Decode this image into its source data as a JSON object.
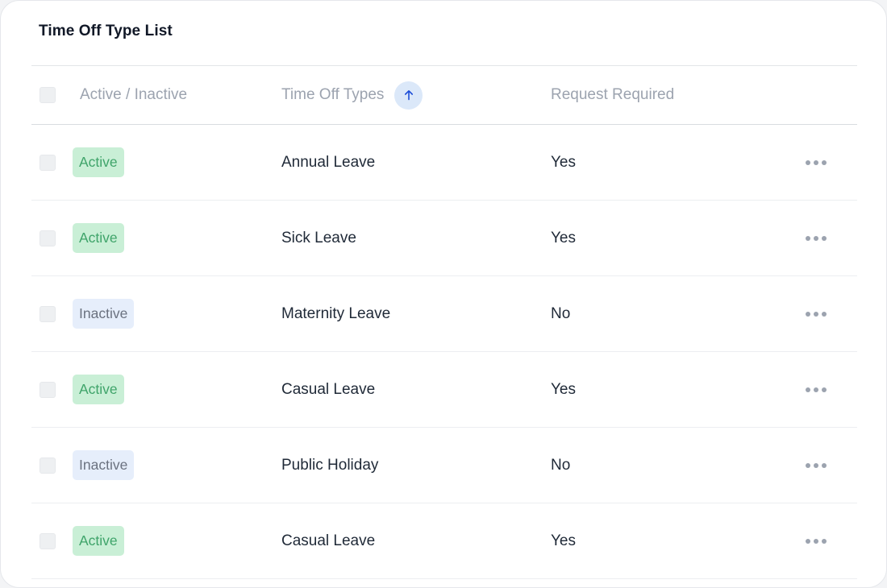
{
  "card": {
    "title": "Time Off Type List"
  },
  "table": {
    "headers": {
      "status": "Active / Inactive",
      "type": "Time Off Types",
      "required": "Request Required"
    },
    "sort_icon": "arrow-up-icon",
    "rows": [
      {
        "status": "Active",
        "status_kind": "active",
        "type": "Annual Leave",
        "required": "Yes"
      },
      {
        "status": "Active",
        "status_kind": "active",
        "type": "Sick Leave",
        "required": "Yes"
      },
      {
        "status": "Inactive",
        "status_kind": "inactive",
        "type": "Maternity Leave",
        "required": "No"
      },
      {
        "status": "Active",
        "status_kind": "active",
        "type": "Casual Leave",
        "required": "Yes"
      },
      {
        "status": "Inactive",
        "status_kind": "inactive",
        "type": "Public Holiday",
        "required": "No"
      },
      {
        "status": "Active",
        "status_kind": "active",
        "type": "Casual Leave",
        "required": "Yes"
      }
    ],
    "row_action_icon": "more-horizontal-icon"
  },
  "colors": {
    "active_bg": "#c9efd6",
    "active_text": "#3fa46a",
    "inactive_bg": "#e6eefb",
    "inactive_text": "#6b7280",
    "sort_accent": "#1d4ed8"
  }
}
